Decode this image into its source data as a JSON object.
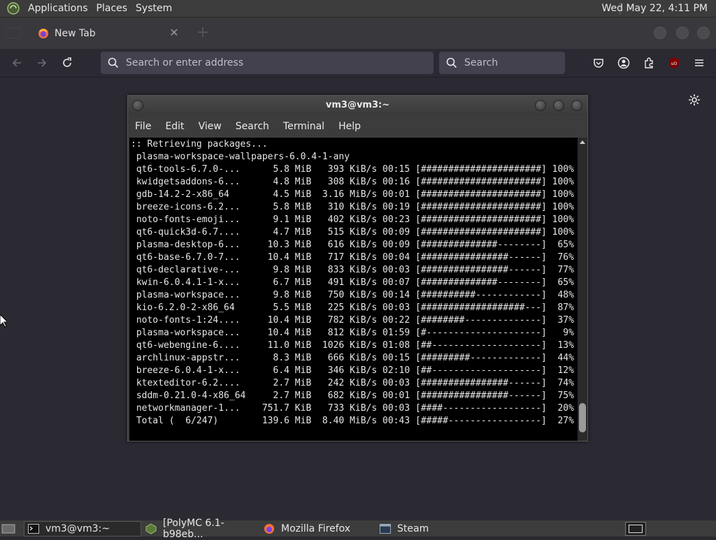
{
  "top_panel": {
    "menu": [
      "Applications",
      "Places",
      "System"
    ],
    "clock": "Wed May 22,  4:11 PM"
  },
  "firefox": {
    "tab_title": "New Tab",
    "urlbar_placeholder": "Search or enter address",
    "searchbar_placeholder": "Search"
  },
  "terminal": {
    "title": "vm3@vm3:~",
    "menu": [
      "File",
      "Edit",
      "View",
      "Search",
      "Terminal",
      "Help"
    ],
    "lines": [
      ":: Retrieving packages...",
      " plasma-workspace-wallpapers-6.0.4-1-any",
      " qt6-tools-6.7.0-...      5.8 MiB   393 KiB/s 00:15 [######################] 100%",
      " kwidgetsaddons-6...      4.8 MiB   308 KiB/s 00:16 [######################] 100%",
      " gdb-14.2-2-x86_64        4.5 MiB  3.16 MiB/s 00:01 [######################] 100%",
      " breeze-icons-6.2...      5.8 MiB   310 KiB/s 00:19 [######################] 100%",
      " noto-fonts-emoji...      9.1 MiB   402 KiB/s 00:23 [######################] 100%",
      " qt6-quick3d-6.7....      4.7 MiB   515 KiB/s 00:09 [######################] 100%",
      " plasma-desktop-6...     10.3 MiB   616 KiB/s 00:09 [##############--------]  65%",
      " qt6-base-6.7.0-7...     10.4 MiB   717 KiB/s 00:04 [################------]  76%",
      " qt6-declarative-...      9.8 MiB   833 KiB/s 00:03 [################------]  77%",
      " kwin-6.0.4.1-1-x...      6.7 MiB   491 KiB/s 00:07 [##############--------]  65%",
      " plasma-workspace...      9.8 MiB   750 KiB/s 00:14 [##########------------]  48%",
      " kio-6.2.0-2-x86_64       5.5 MiB   225 KiB/s 00:03 [###################---]  87%",
      " noto-fonts-1:24....     10.4 MiB   782 KiB/s 00:22 [########--------------]  37%",
      " plasma-workspace...     10.4 MiB   812 KiB/s 01:59 [#---------------------]   9%",
      " qt6-webengine-6....     11.0 MiB  1026 KiB/s 01:08 [##--------------------]  13%",
      " archlinux-appstr...      8.3 MiB   666 KiB/s 00:15 [#########-------------]  44%",
      " breeze-6.0.4-1-x...      6.4 MiB   346 KiB/s 02:10 [##--------------------]  12%",
      " ktexteditor-6.2....      2.7 MiB   242 KiB/s 00:03 [################------]  74%",
      " sddm-0.21.0-4-x86_64     2.7 MiB   682 KiB/s 00:01 [################------]  75%",
      " networkmanager-1...    751.7 KiB   733 KiB/s 00:03 [####------------------]  20%",
      " Total (  6/247)        139.6 MiB  8.40 MiB/s 00:43 [#####-----------------]  27%"
    ]
  },
  "taskbar": {
    "tasks": [
      {
        "label": "vm3@vm3:~",
        "active": true
      },
      {
        "label": "[PolyMC 6.1-b98eb...",
        "active": false
      },
      {
        "label": "Mozilla Firefox",
        "active": false
      },
      {
        "label": "Steam",
        "active": false
      }
    ]
  }
}
